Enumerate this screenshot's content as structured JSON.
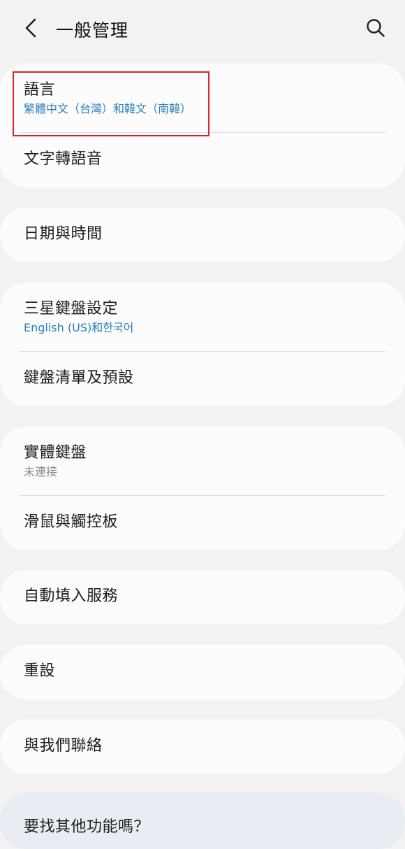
{
  "header": {
    "title": "一般管理",
    "back_icon": "chevron-left-icon",
    "search_icon": "search-icon"
  },
  "sections": [
    {
      "items": [
        {
          "title": "語言",
          "subtitle": "繁體中文（台灣）和韓文（南韓）"
        },
        {
          "title": "文字轉語音"
        }
      ]
    },
    {
      "items": [
        {
          "title": "日期與時間"
        }
      ]
    },
    {
      "items": [
        {
          "title": "三星鍵盤設定",
          "subtitle": "English (US)和한국어"
        },
        {
          "title": "鍵盤清單及預設"
        }
      ]
    },
    {
      "items": [
        {
          "title": "實體鍵盤",
          "subtitle": "未連接"
        },
        {
          "title": "滑鼠與觸控板"
        }
      ]
    },
    {
      "items": [
        {
          "title": "自動填入服務"
        }
      ]
    },
    {
      "items": [
        {
          "title": "重設"
        }
      ]
    },
    {
      "items": [
        {
          "title": "與我們聯絡"
        }
      ]
    }
  ],
  "bottom_card": {
    "title": "要找其他功能嗎？"
  },
  "colors": {
    "background": "#f2f2f2",
    "card": "#fcfcfc",
    "subtitle_blue": "#2b7fbf",
    "subtitle_gray": "#8a8a8a",
    "highlight": "#e0212a"
  }
}
